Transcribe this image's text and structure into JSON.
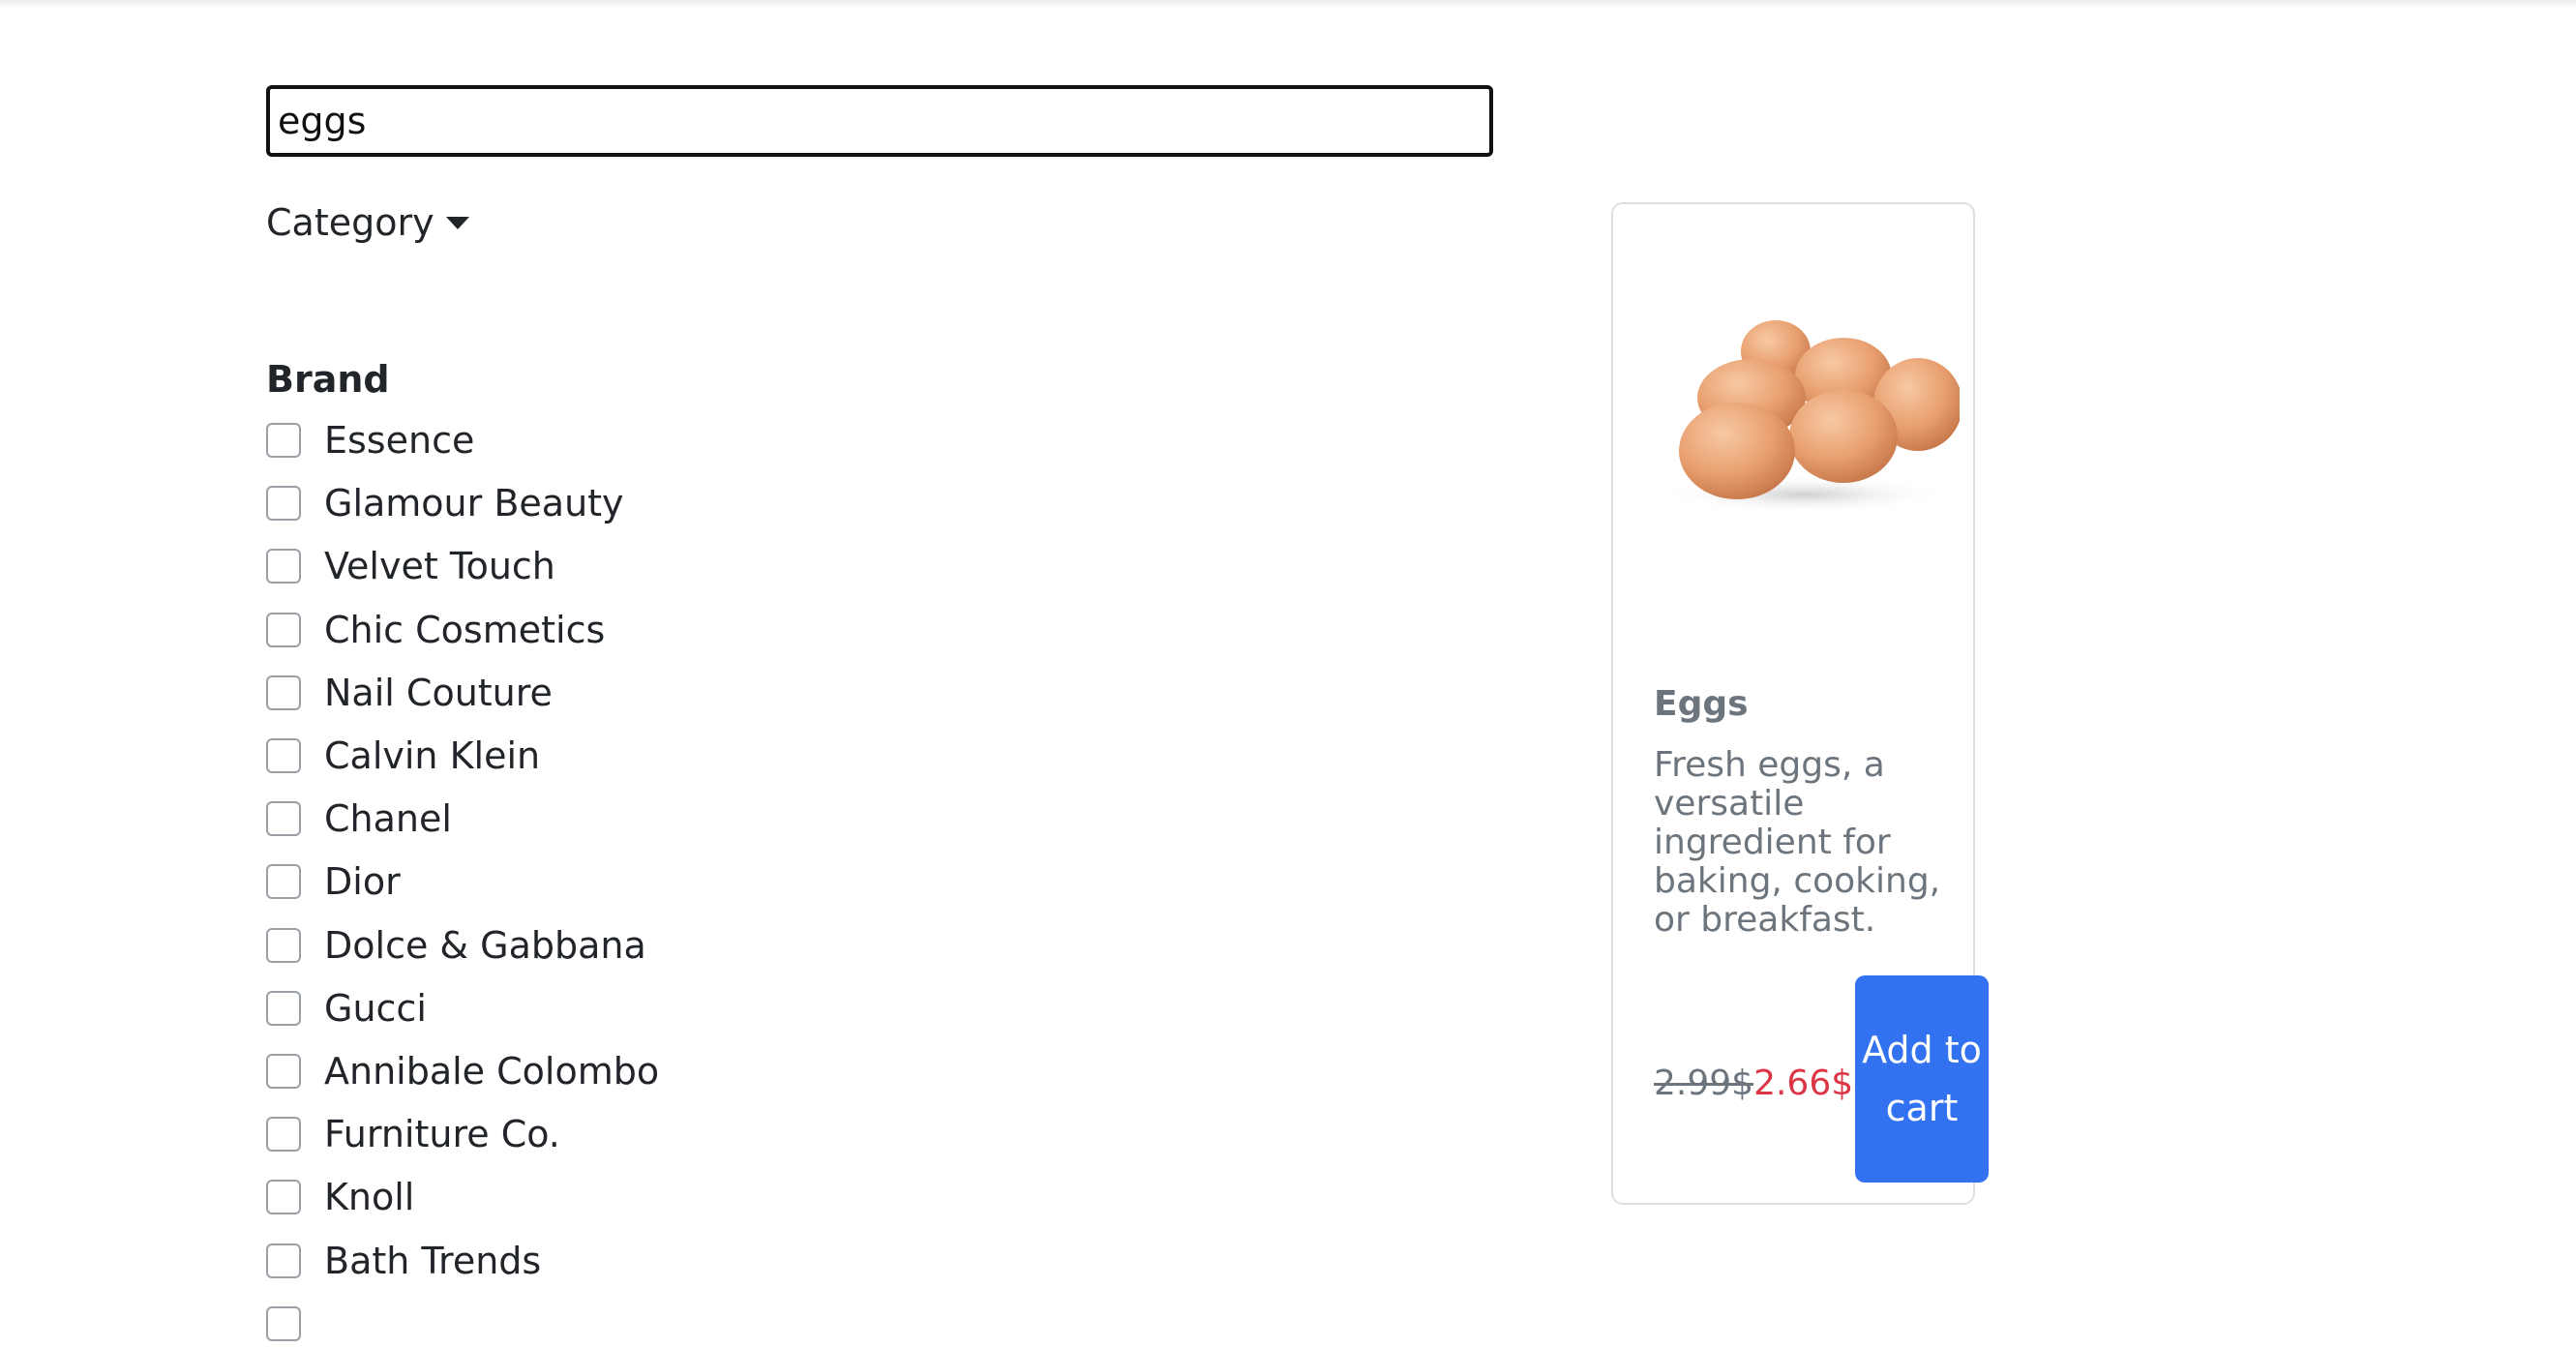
{
  "search": {
    "value": "eggs"
  },
  "filters": {
    "category_label": "Category",
    "brand_heading": "Brand",
    "brands": [
      "Essence",
      "Glamour Beauty",
      "Velvet Touch",
      "Chic Cosmetics",
      "Nail Couture",
      "Calvin Klein",
      "Chanel",
      "Dior",
      "Dolce & Gabbana",
      "Gucci",
      "Annibale Colombo",
      "Furniture Co.",
      "Knoll",
      "Bath Trends",
      ""
    ]
  },
  "product": {
    "title": "Eggs",
    "description": "Fresh eggs, a versatile ingredient for baking, cooking, or breakfast.",
    "old_price": "2.99$",
    "new_price": "2.66$",
    "extra": "9",
    "add_to_cart_label": "Add to cart",
    "image_icon": "eggs-image"
  },
  "colors": {
    "button": "#3272f0",
    "sale_price": "#dc3545",
    "muted_text": "#6c757d"
  }
}
